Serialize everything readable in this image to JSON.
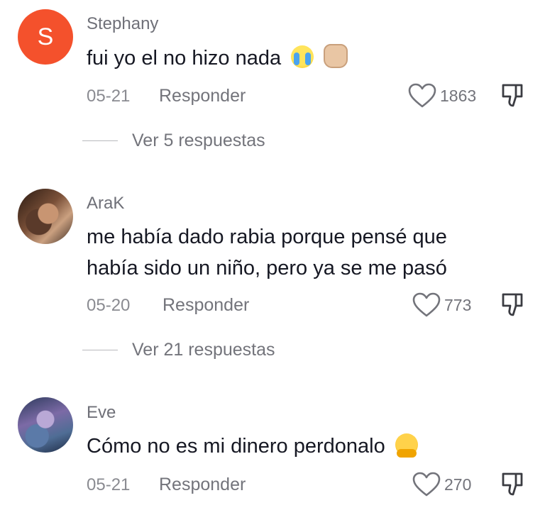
{
  "comments": [
    {
      "avatar_letter": "S",
      "username": "Stephany",
      "text": "fui yo el no hizo nada",
      "emojis": [
        "loudly-crying-face",
        "raised-fist-medium-light-skin"
      ],
      "date": "05-21",
      "reply_label": "Responder",
      "likes": "1863",
      "view_replies": "Ver 5 respuestas"
    },
    {
      "username": "AraK",
      "text_line1": "me había dado rabia porque pensé que",
      "text_line2": "había sido un niño, pero ya se me pasó",
      "date": "05-20",
      "reply_label": "Responder",
      "likes": "773",
      "view_replies": "Ver 21 respuestas"
    },
    {
      "username": "Eve",
      "text": "Cómo no es mi dinero perdonalo",
      "emojis": [
        "hugging-face"
      ],
      "date": "05-21",
      "reply_label": "Responder",
      "likes": "270"
    }
  ],
  "colors": {
    "avatar_letter_bg": "#f4512c",
    "primary_text": "#161823",
    "secondary_text": "#73747b"
  }
}
